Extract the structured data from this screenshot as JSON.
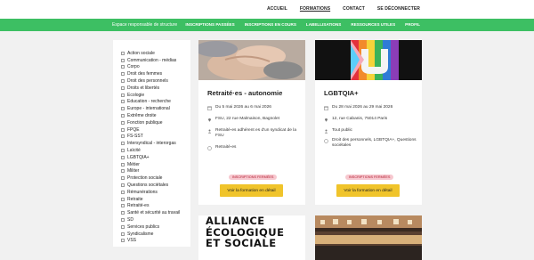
{
  "topnav": {
    "items": [
      "ACCUEIL",
      "FORMATIONS",
      "CONTACT",
      "SE DÉCONNECTER"
    ]
  },
  "greenbar": {
    "title": "Espace responsable de structure",
    "items": [
      "INSCRIPTIONS PASSÉES",
      "INSCRIPTIONS EN COURS",
      "LABELLISATIONS",
      "RESSOURCES UTILES",
      "PROFIL"
    ]
  },
  "sidebar": {
    "filters": [
      "Action sociale",
      "Communication - médias",
      "Corpo",
      "Droit des femmes",
      "Droit des personnels",
      "Droits et libertés",
      "Ecologie",
      "Education - recherche",
      "Europe - international",
      "Extrême droite",
      "Fonction publique",
      "FPQE",
      "FS-SST",
      "Intersyndical - interorgas",
      "Laïcité",
      "LGBTQIA+",
      "Métier",
      "Militer",
      "Protection sociale",
      "Questions sociétales",
      "Rémunérations",
      "Retraite",
      "Retraité-es",
      "Santé et sécurité au travail",
      "SD",
      "Services publics",
      "Syndicalisme",
      "VSS"
    ]
  },
  "cards": [
    {
      "title": "Retraité·es - autonomie",
      "date": "Du 5 mai 2026 au 6 mai 2026",
      "place": "FSU, 22 rue Malmaison, Bagnolet",
      "public": "Retraité-es adhérent es d'un syndicat de la FSU",
      "theme": "Retraité-es",
      "badge": "INSCRIPTIONS FERMÉES",
      "button": "Voir la formation en détail"
    },
    {
      "title": "LGBTQIA+",
      "date": "Du 28 mai 2026 au 29 mai 2026",
      "place": "12, rue Cabanis, 75014 Paris",
      "public": "Tout public",
      "theme": "Droit des personnels, LGBTQIA+, Questions sociétales",
      "badge": "INSCRIPTIONS FERMÉES",
      "button": "Voir la formation en détail"
    }
  ],
  "card3": {
    "image_text": [
      "ALLIANCE",
      "ÉCOLOGIQUE",
      "ET SOCIALE"
    ]
  },
  "colors": {
    "green": "#3dbf63",
    "yellow": "#f0c42b",
    "badge_bg": "#f7c8cf",
    "badge_fg": "#b0182d"
  }
}
